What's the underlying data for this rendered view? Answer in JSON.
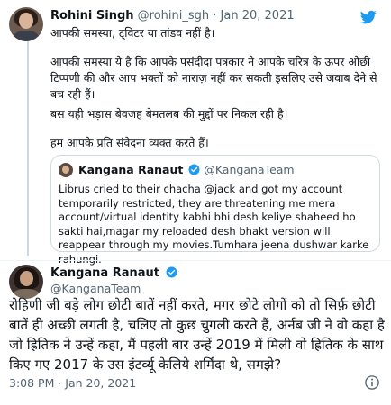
{
  "top_tweet": {
    "name": "Rohini Singh",
    "meta": "@rohini_sgh · Jan 20, 2021",
    "lines": [
      "आपकी समस्या, ट्विटर या तांडव नहीं है।",
      "आपकी समस्या ये है कि आपके पसंदीदा पत्रकार ने आपके चरित्र के ऊपर ओछी टिप्पणी की और आप भक्तों को नाराज़ नहीं कर सकती इसलिए उसे जवाब देने से बच रही हैं।",
      "बस यही भड़ास बेवजह बेमतलब की मुद्दों पर निकल रही है।",
      "हम आपके प्रति संवेदना व्यक्त करते हैं।"
    ],
    "quoted": {
      "name": "Kangana Ranaut",
      "handle": "@KanganaTeam",
      "text": "Librus cried to their chacha @jack and got my account temporarily restricted, they are threatening me mera account/virtual identity kabhi bhi desh keliye shaheed ho sakti hai,magar my reloaded desh bhakt version will reappear through my movies.Tumhara jeena dushwar karke rahungi."
    }
  },
  "main_tweet": {
    "name": "Kangana Ranaut",
    "handle": "@KanganaTeam",
    "text": "रोहिणी जी बड़े लोग छोटी बातें नहीं करते, मगर छोटे लोगों को तो सिर्फ़ छोटी बातें ही अच्छी लगती है, चलिए तो कुछ चुगली करते हैं, अर्नब जी ने वो कहा है जो ह्रितिक ने उन्हें कहा, मैं पहली बार उन्हें 2019 में मिली वो ह्रितिक के साथ किए गए 2017 के उस इंटर्व्यू केलिये शर्मिंदा थे, समझे?",
    "footer": "3:08 PM · Jan 20, 2021"
  },
  "colors": {
    "twitter_blue": "#1d9bf0",
    "secondary_text": "#536471",
    "border": "#cfd9de"
  },
  "icons": {
    "logo": "twitter-bird-icon",
    "verified": "verified-badge-icon",
    "info": "info-icon"
  }
}
